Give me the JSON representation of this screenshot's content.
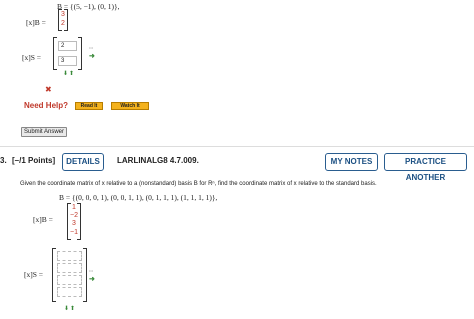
{
  "q_prev": {
    "b_line": "B = {(5, −1), (0, 1)},",
    "xb_label": "[x]B =",
    "xb_values": [
      "3",
      "2"
    ],
    "xs_label": "[x]S =",
    "xs_answers": [
      "2",
      "3"
    ],
    "tiny_hint": "•••",
    "wrong_mark": "✖",
    "need_help": "Need Help?",
    "read_it": "Read It",
    "watch_it": "Watch It",
    "submit": "Submit Answer"
  },
  "q_next": {
    "number": "3.",
    "points": "[–/1 Points]",
    "details": "DETAILS",
    "code": "LARLINALG8 4.7.009.",
    "my_notes": "MY NOTES",
    "practice": "PRACTICE ANOTHER",
    "prompt": "Given the coordinate matrix of x relative to a (nonstandard) basis B for Rⁿ, find the coordinate matrix of x relative to the standard basis.",
    "b_line": "B = {(0, 0, 0, 1), (0, 0, 1, 1), (0, 1, 1, 1), (1, 1, 1, 1)},",
    "xb_label": "[x]B =",
    "xb_values": [
      "1",
      "−2",
      "3",
      "−1"
    ],
    "xs_label": "[x]S =",
    "tiny_hint": "•••"
  },
  "colors": {
    "accent_blue": "#1b4f82",
    "red_value": "#c0392b",
    "help_red": "#c0392b",
    "orange_btn": "#f4b21d"
  }
}
